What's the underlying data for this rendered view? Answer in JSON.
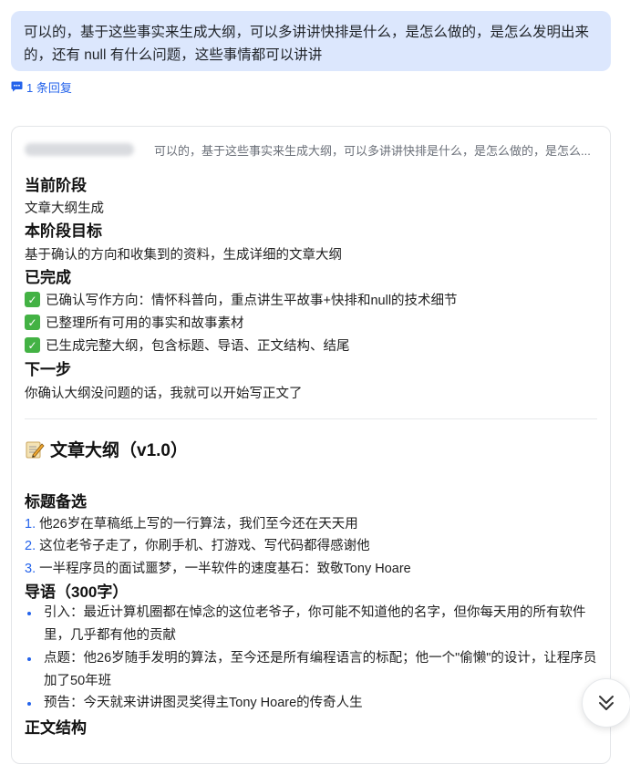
{
  "user_message": {
    "line1": "可以的，基于这些事实来生成大纲，可以多讲讲快排是什么，是怎么做的，是怎么发明出来",
    "line2": "的，还有 null 有什么问题，这些事情都可以讲讲"
  },
  "reply_link": {
    "icon": "comment-icon",
    "label": "1 条回复"
  },
  "quote": {
    "text": "可以的，基于这些事实来生成大纲，可以多讲讲快排是什么，是怎么做的，是怎么..."
  },
  "status": {
    "current_stage_title": "当前阶段",
    "current_stage": "文章大纲生成",
    "goal_title": "本阶段目标",
    "goal": "基于确认的方向和收集到的资料，生成详细的文章大纲",
    "done_title": "已完成",
    "done_items": [
      "已确认写作方向：情怀科普向，重点讲生平故事+快排和null的技术细节",
      "已整理所有可用的事实和故事素材",
      "已生成完整大纲，包含标题、导语、正文结构、结尾"
    ],
    "next_title": "下一步",
    "next": "你确认大纲没问题的话，我就可以开始写正文了"
  },
  "outline": {
    "icon": "memo-icon",
    "title": "文章大纲（v1.0）",
    "titles_heading": "标题备选",
    "titles": [
      {
        "num": "1.",
        "text": "他26岁在草稿纸上写的一行算法，我们至今还在天天用"
      },
      {
        "num": "2.",
        "text": "这位老爷子走了，你刷手机、打游戏、写代码都得感谢他"
      },
      {
        "num": "3.",
        "text": "一半程序员的面试噩梦，一半软件的速度基石：致敬Tony Hoare"
      }
    ],
    "intro_heading": "导语（300字）",
    "intro_items": [
      "引入：最近计算机圈都在悼念的这位老爷子，你可能不知道他的名字，但你每天用的所有软件里，几乎都有他的贡献",
      "点题：他26岁随手发明的算法，至今还是所有编程语言的标配；他一个\"偷懒\"的设计，让程序员加了50年班",
      "预告：今天就来讲讲图灵奖得主Tony Hoare的传奇人生"
    ],
    "body_heading": "正文结构"
  },
  "scroll_button": {
    "icon": "double-chevron-down-icon"
  },
  "colors": {
    "accent": "#2463eb",
    "bubble": "#dce7fd",
    "check": "#43b244"
  }
}
